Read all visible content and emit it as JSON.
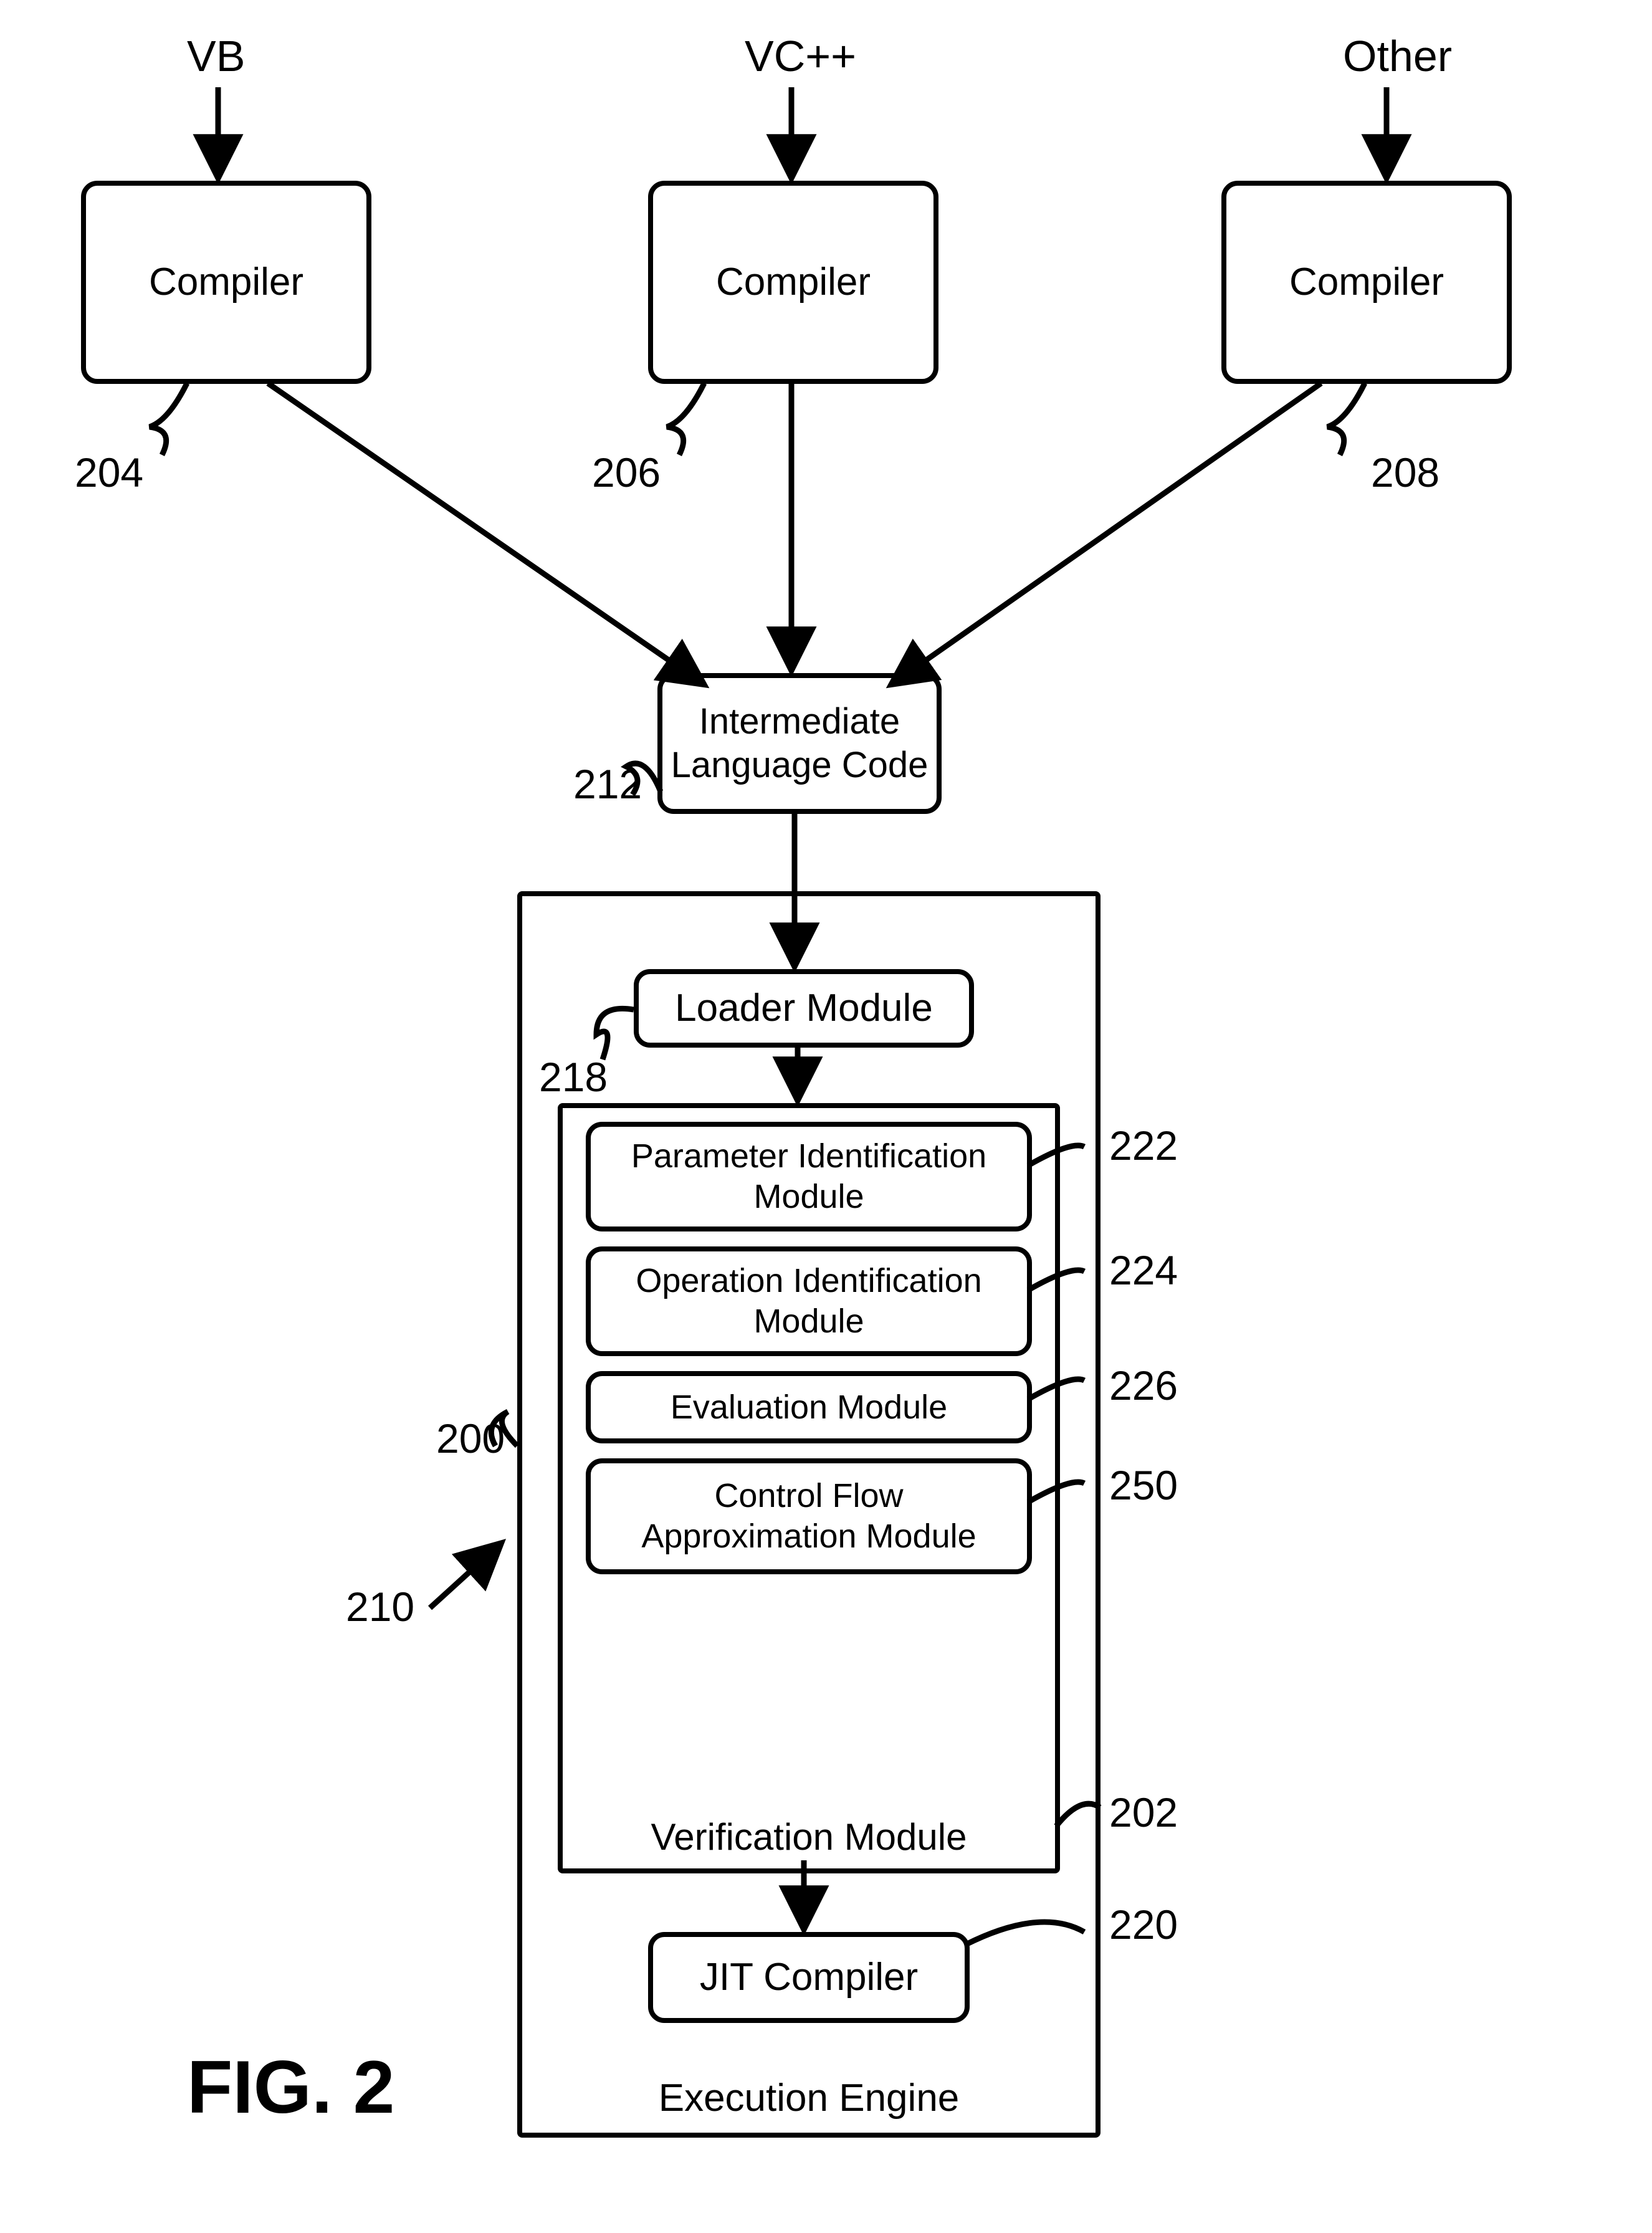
{
  "sources": {
    "vb": {
      "label": "VB",
      "box": "Compiler",
      "ref": "204"
    },
    "vcpp": {
      "label": "VC++",
      "box": "Compiler",
      "ref": "206"
    },
    "other": {
      "label": "Other",
      "box": "Compiler",
      "ref": "208"
    }
  },
  "intermediate": {
    "text": "Intermediate\nLanguage Code",
    "ref": "212"
  },
  "engine": {
    "title": "Execution Engine",
    "pointer": "210",
    "pointer2": "200",
    "loader": {
      "text": "Loader Module",
      "ref": "218"
    },
    "verification": {
      "title": "Verification Module",
      "ref": "202",
      "items": [
        {
          "text": "Parameter Identification\nModule",
          "ref": "222"
        },
        {
          "text": "Operation Identification\nModule",
          "ref": "224"
        },
        {
          "text": "Evaluation Module",
          "ref": "226"
        },
        {
          "text": "Control Flow\nApproximation Module",
          "ref": "250"
        }
      ]
    },
    "jit": {
      "text": "JIT Compiler",
      "ref": "220"
    }
  },
  "figure_label": "FIG. 2"
}
